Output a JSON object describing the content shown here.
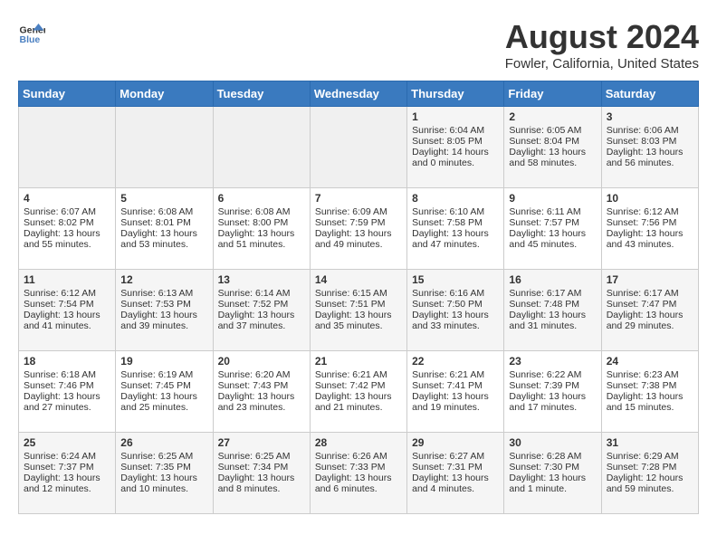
{
  "header": {
    "logo_line1": "General",
    "logo_line2": "Blue",
    "month": "August 2024",
    "location": "Fowler, California, United States"
  },
  "days_of_week": [
    "Sunday",
    "Monday",
    "Tuesday",
    "Wednesday",
    "Thursday",
    "Friday",
    "Saturday"
  ],
  "weeks": [
    [
      {
        "day": "",
        "empty": true
      },
      {
        "day": "",
        "empty": true
      },
      {
        "day": "",
        "empty": true
      },
      {
        "day": "",
        "empty": true
      },
      {
        "day": "1",
        "sunrise": "Sunrise: 6:04 AM",
        "sunset": "Sunset: 8:05 PM",
        "daylight": "Daylight: 14 hours and 0 minutes."
      },
      {
        "day": "2",
        "sunrise": "Sunrise: 6:05 AM",
        "sunset": "Sunset: 8:04 PM",
        "daylight": "Daylight: 13 hours and 58 minutes."
      },
      {
        "day": "3",
        "sunrise": "Sunrise: 6:06 AM",
        "sunset": "Sunset: 8:03 PM",
        "daylight": "Daylight: 13 hours and 56 minutes."
      }
    ],
    [
      {
        "day": "4",
        "sunrise": "Sunrise: 6:07 AM",
        "sunset": "Sunset: 8:02 PM",
        "daylight": "Daylight: 13 hours and 55 minutes."
      },
      {
        "day": "5",
        "sunrise": "Sunrise: 6:08 AM",
        "sunset": "Sunset: 8:01 PM",
        "daylight": "Daylight: 13 hours and 53 minutes."
      },
      {
        "day": "6",
        "sunrise": "Sunrise: 6:08 AM",
        "sunset": "Sunset: 8:00 PM",
        "daylight": "Daylight: 13 hours and 51 minutes."
      },
      {
        "day": "7",
        "sunrise": "Sunrise: 6:09 AM",
        "sunset": "Sunset: 7:59 PM",
        "daylight": "Daylight: 13 hours and 49 minutes."
      },
      {
        "day": "8",
        "sunrise": "Sunrise: 6:10 AM",
        "sunset": "Sunset: 7:58 PM",
        "daylight": "Daylight: 13 hours and 47 minutes."
      },
      {
        "day": "9",
        "sunrise": "Sunrise: 6:11 AM",
        "sunset": "Sunset: 7:57 PM",
        "daylight": "Daylight: 13 hours and 45 minutes."
      },
      {
        "day": "10",
        "sunrise": "Sunrise: 6:12 AM",
        "sunset": "Sunset: 7:56 PM",
        "daylight": "Daylight: 13 hours and 43 minutes."
      }
    ],
    [
      {
        "day": "11",
        "sunrise": "Sunrise: 6:12 AM",
        "sunset": "Sunset: 7:54 PM",
        "daylight": "Daylight: 13 hours and 41 minutes."
      },
      {
        "day": "12",
        "sunrise": "Sunrise: 6:13 AM",
        "sunset": "Sunset: 7:53 PM",
        "daylight": "Daylight: 13 hours and 39 minutes."
      },
      {
        "day": "13",
        "sunrise": "Sunrise: 6:14 AM",
        "sunset": "Sunset: 7:52 PM",
        "daylight": "Daylight: 13 hours and 37 minutes."
      },
      {
        "day": "14",
        "sunrise": "Sunrise: 6:15 AM",
        "sunset": "Sunset: 7:51 PM",
        "daylight": "Daylight: 13 hours and 35 minutes."
      },
      {
        "day": "15",
        "sunrise": "Sunrise: 6:16 AM",
        "sunset": "Sunset: 7:50 PM",
        "daylight": "Daylight: 13 hours and 33 minutes."
      },
      {
        "day": "16",
        "sunrise": "Sunrise: 6:17 AM",
        "sunset": "Sunset: 7:48 PM",
        "daylight": "Daylight: 13 hours and 31 minutes."
      },
      {
        "day": "17",
        "sunrise": "Sunrise: 6:17 AM",
        "sunset": "Sunset: 7:47 PM",
        "daylight": "Daylight: 13 hours and 29 minutes."
      }
    ],
    [
      {
        "day": "18",
        "sunrise": "Sunrise: 6:18 AM",
        "sunset": "Sunset: 7:46 PM",
        "daylight": "Daylight: 13 hours and 27 minutes."
      },
      {
        "day": "19",
        "sunrise": "Sunrise: 6:19 AM",
        "sunset": "Sunset: 7:45 PM",
        "daylight": "Daylight: 13 hours and 25 minutes."
      },
      {
        "day": "20",
        "sunrise": "Sunrise: 6:20 AM",
        "sunset": "Sunset: 7:43 PM",
        "daylight": "Daylight: 13 hours and 23 minutes."
      },
      {
        "day": "21",
        "sunrise": "Sunrise: 6:21 AM",
        "sunset": "Sunset: 7:42 PM",
        "daylight": "Daylight: 13 hours and 21 minutes."
      },
      {
        "day": "22",
        "sunrise": "Sunrise: 6:21 AM",
        "sunset": "Sunset: 7:41 PM",
        "daylight": "Daylight: 13 hours and 19 minutes."
      },
      {
        "day": "23",
        "sunrise": "Sunrise: 6:22 AM",
        "sunset": "Sunset: 7:39 PM",
        "daylight": "Daylight: 13 hours and 17 minutes."
      },
      {
        "day": "24",
        "sunrise": "Sunrise: 6:23 AM",
        "sunset": "Sunset: 7:38 PM",
        "daylight": "Daylight: 13 hours and 15 minutes."
      }
    ],
    [
      {
        "day": "25",
        "sunrise": "Sunrise: 6:24 AM",
        "sunset": "Sunset: 7:37 PM",
        "daylight": "Daylight: 13 hours and 12 minutes."
      },
      {
        "day": "26",
        "sunrise": "Sunrise: 6:25 AM",
        "sunset": "Sunset: 7:35 PM",
        "daylight": "Daylight: 13 hours and 10 minutes."
      },
      {
        "day": "27",
        "sunrise": "Sunrise: 6:25 AM",
        "sunset": "Sunset: 7:34 PM",
        "daylight": "Daylight: 13 hours and 8 minutes."
      },
      {
        "day": "28",
        "sunrise": "Sunrise: 6:26 AM",
        "sunset": "Sunset: 7:33 PM",
        "daylight": "Daylight: 13 hours and 6 minutes."
      },
      {
        "day": "29",
        "sunrise": "Sunrise: 6:27 AM",
        "sunset": "Sunset: 7:31 PM",
        "daylight": "Daylight: 13 hours and 4 minutes."
      },
      {
        "day": "30",
        "sunrise": "Sunrise: 6:28 AM",
        "sunset": "Sunset: 7:30 PM",
        "daylight": "Daylight: 13 hours and 1 minute."
      },
      {
        "day": "31",
        "sunrise": "Sunrise: 6:29 AM",
        "sunset": "Sunset: 7:28 PM",
        "daylight": "Daylight: 12 hours and 59 minutes."
      }
    ]
  ]
}
